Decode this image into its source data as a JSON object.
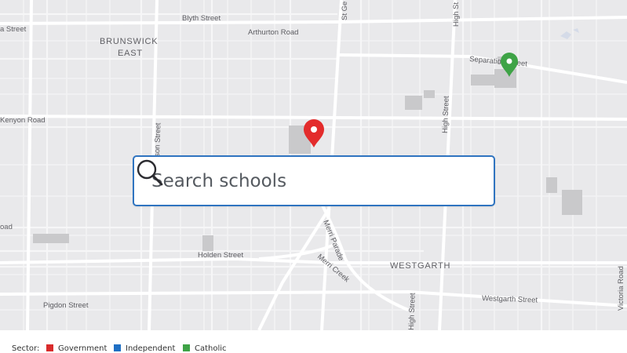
{
  "map": {
    "streets": {
      "blyth": "Blyth Street",
      "arthurton": "Arthurton Road",
      "st_georges": "St Ge",
      "high_top": "High St",
      "separation": "Separation Street",
      "kenyon": "Kenyon Road",
      "nicholson": "son Street",
      "high_mid": "High Street",
      "holden": "Holden Street",
      "merri_parade": "Merri Parade",
      "merri_creek": "Merri Creek",
      "westgarth_st": "Westgarth Street",
      "victoria": "Victoria Road",
      "pigdon": "Pigdon Street",
      "high_bottom": "High Street",
      "left_top": "a Street",
      "left_mid": "oad"
    },
    "suburbs": {
      "brunswick_east_1": "BRUNSWICK",
      "brunswick_east_2": "EAST",
      "westgarth": "WESTGARTH"
    },
    "markers": [
      {
        "sector": "Government",
        "color": "#e32c2c"
      },
      {
        "sector": "Catholic",
        "color": "#3ea346"
      }
    ]
  },
  "search": {
    "placeholder": "Search schools",
    "icon": "search-icon"
  },
  "legend": {
    "label": "Sector:",
    "items": [
      {
        "name": "Government",
        "color": "#d92b2b"
      },
      {
        "name": "Independent",
        "color": "#1f6fc4"
      },
      {
        "name": "Catholic",
        "color": "#3ea346"
      }
    ]
  }
}
